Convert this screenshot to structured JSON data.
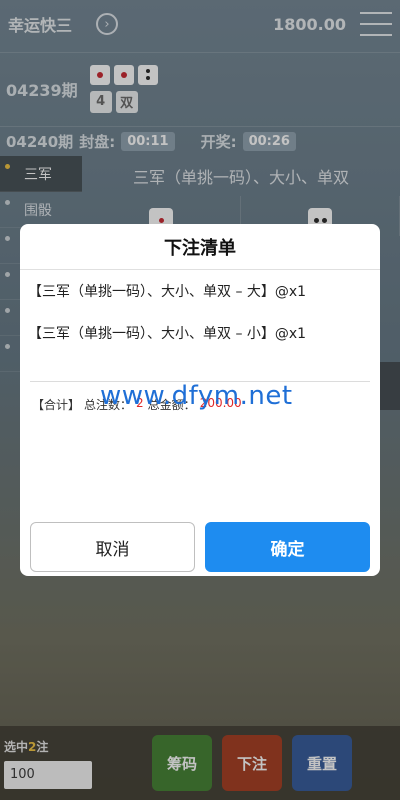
{
  "topbar": {
    "title": "幸运快三",
    "switch_icon": "circle-chevron-right-icon",
    "balance": "1800.00",
    "menu_icon": "hamburger-menu-icon"
  },
  "current_period": {
    "number": "04239期",
    "sum": "4",
    "parity": "双"
  },
  "next_period": {
    "number": "04240期",
    "close_label": "封盘:",
    "close_time": "00:11",
    "draw_label": "开奖:",
    "draw_time": "00:26"
  },
  "sidebar": {
    "items": [
      {
        "label": "三军"
      },
      {
        "label": "围骰"
      }
    ]
  },
  "content": {
    "heading": "三军（单挑一码）、大小、单双"
  },
  "bottom": {
    "selected_prefix": "选中",
    "selected_count": "2",
    "selected_suffix": "注",
    "amount_value": "100",
    "chip_label": "筹码",
    "bet_label": "下注",
    "reset_label": "重置"
  },
  "modal": {
    "title": "下注清单",
    "bets": [
      {
        "text": "【三军（单挑一码）、大小、单双 – 大】@x1"
      },
      {
        "text": "【三军（单挑一码）、大小、单双 – 小】@x1"
      }
    ],
    "summary": {
      "label": "【合计】",
      "count_label": "总注数：",
      "count_value": "2",
      "total_label": "总金额：",
      "total_value": "200.00"
    },
    "cancel_label": "取消",
    "confirm_label": "确定"
  },
  "watermark": "www.dfym.net",
  "colors": {
    "confirm": "#1e8cf0",
    "chip": "#3e7d2c",
    "bet": "#a3371a",
    "reset": "#2e5597",
    "highlight": "#f2c23b"
  }
}
